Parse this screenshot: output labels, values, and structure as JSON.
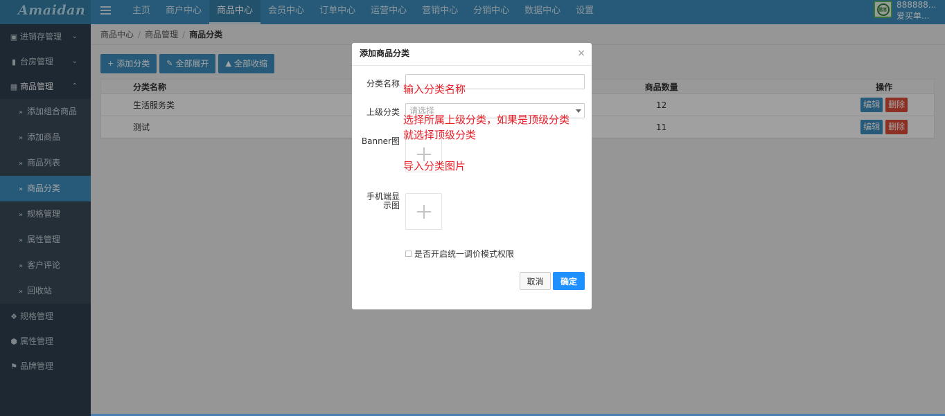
{
  "app": {
    "logo": "Amaidan"
  },
  "topnav": {
    "items": [
      "主页",
      "商户中心",
      "商品中心",
      "会员中心",
      "订单中心",
      "运营中心",
      "营销中心",
      "分销中心",
      "数据中心",
      "设置"
    ],
    "active_index": 2
  },
  "user": {
    "id": "888888...",
    "name": "爱买单...",
    "avatar_text": "篮客"
  },
  "sidebar": {
    "groups": [
      {
        "label": "进销存管理",
        "icon": "map-icon"
      },
      {
        "label": "台房管理",
        "icon": "bookmark-icon"
      },
      {
        "label": "商品管理",
        "icon": "grid-icon"
      },
      {
        "label": "规格管理",
        "icon": "cubes-icon"
      },
      {
        "label": "属性管理",
        "icon": "cube-icon"
      },
      {
        "label": "品牌管理",
        "icon": "tags-icon"
      }
    ],
    "sub_items": [
      "添加组合商品",
      "添加商品",
      "商品列表",
      "商品分类",
      "规格管理",
      "属性管理",
      "客户评论",
      "回收站"
    ],
    "active_sub": "商品分类"
  },
  "breadcrumb": [
    "商品中心",
    "商品管理",
    "商品分类"
  ],
  "toolbar": {
    "add": "添加分类",
    "expand": "全部展开",
    "collapse": "全部收缩"
  },
  "table": {
    "headers": {
      "name": "分类名称",
      "count": "商品数量",
      "ops": "操作"
    },
    "rows": [
      {
        "name": "生活服务类",
        "count": "12"
      },
      {
        "name": "测试",
        "count": "11"
      }
    ],
    "edit_label": "编辑",
    "delete_label": "删除"
  },
  "modal": {
    "title": "添加商品分类",
    "close": "×",
    "labels": {
      "name": "分类名称",
      "parent": "上级分类",
      "banner": "Banner图",
      "mobile_line1": "手机端显",
      "mobile_line2": "示图"
    },
    "parent_placeholder": "请选择",
    "checkbox_label": "是否开启统一调价模式权限",
    "cancel": "取消",
    "ok": "确定"
  },
  "annotations": {
    "name": "输入分类名称",
    "parent_line1": "选择所属上级分类，如果是顶级分类",
    "parent_line2": "就选择顶级分类",
    "image": "导入分类图片"
  },
  "colors": {
    "accent": "#3c8dbc",
    "danger": "#dd4b39",
    "primary": "#1e90ff",
    "annotation": "#e8202a"
  }
}
